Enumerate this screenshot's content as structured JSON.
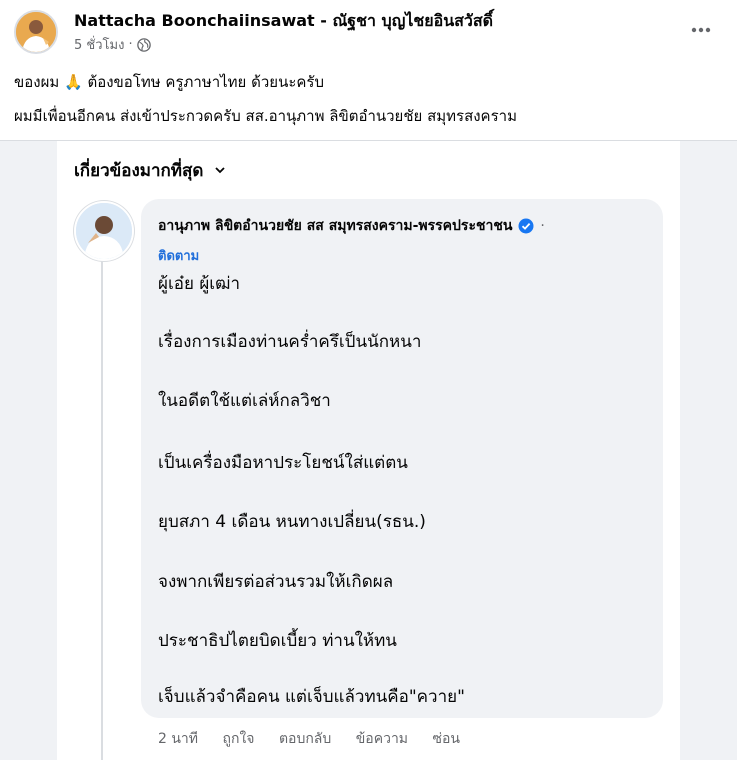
{
  "post": {
    "author": "Nattacha Boonchaiinsawat - ณัฐชา บุญไชยอินสวัสดิ์",
    "time": "5 ชั่วโมง",
    "separator": "·",
    "line1": "ของผม 🙏 ต้องขอโทษ ครูภาษาไทย ด้วยนะครับ",
    "line2": "ผมมีเพื่อนอีกคน ส่งเข้าประกวดครับ สส.อานุภาพ ลิขิตอำนวยชัย สมุทรสงคราม"
  },
  "screenshot": {
    "sort_label": "เกี่ยวข้องมากที่สุด",
    "comment": {
      "author": "อานุภาพ ลิขิตอำนวยชัย สส สมุทรสงคราม-พรรคประชาชน",
      "dot": "·",
      "follow": "ติดตาม",
      "lines": [
        "ผู้เอ๋ย ผู้เฒ่า",
        "เรื่องการเมืองท่านคร่ำครึเป็นนักหนา",
        "ในอดีตใช้แต่เล่ห์กลวิชา",
        "เป็นเครื่องมือหาประโยชน์ใส่แต่ตน",
        "ยุบสภา 4 เดือน หนทางเปลี่ยน(รธน.)",
        "จงพากเพียรต่อส่วนรวมให้เกิดผล",
        "ประชาธิปไตยบิดเบี้ยว ท่านให้ทน",
        "เจ็บแล้วจำคือคน แต่เจ็บแล้วทนคือ\"ควาย\""
      ],
      "actions": {
        "time": "2 นาที",
        "like": "ถูกใจ",
        "reply": "ตอบกลับ",
        "message": "ข้อความ",
        "hide": "ซ่อน"
      }
    }
  },
  "colors": {
    "link_blue": "#216fdb",
    "verified_blue": "#1877f2",
    "muted": "#65676b",
    "bubble": "#f0f2f5"
  },
  "icons": [
    "globe-icon",
    "more-options-icon",
    "chevron-down-icon",
    "verified-badge-icon"
  ]
}
